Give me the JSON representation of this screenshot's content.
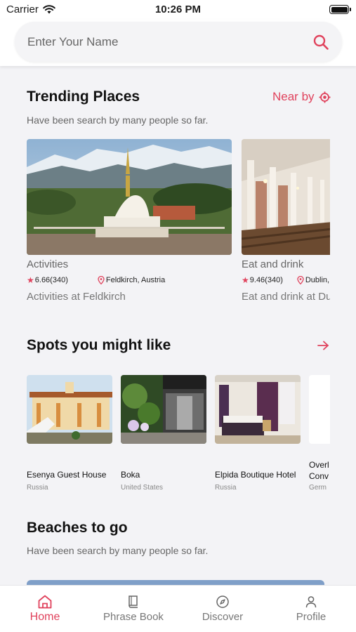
{
  "status_bar": {
    "carrier": "Carrier",
    "time": "10:26 PM"
  },
  "search": {
    "placeholder": "Enter Your Name"
  },
  "trending": {
    "title": "Trending Places",
    "subtitle": "Have been search by many people so far.",
    "nearby_label": "Near by",
    "cards": [
      {
        "category": "Activities",
        "rating": "6.66(340)",
        "location": "Feldkirch, Austria",
        "description": "Activities at Feldkirch"
      },
      {
        "category": "Eat and drink",
        "rating": "9.46(340)",
        "location": "Dublin, Ireland",
        "description": "Eat and drink at Dublin"
      }
    ]
  },
  "spots": {
    "title": "Spots you might like",
    "items": [
      {
        "name": "Esenya Guest House",
        "country": "Russia"
      },
      {
        "name": "Boka",
        "country": "United States"
      },
      {
        "name": "Elpida Boutique Hotel",
        "country": "Russia"
      },
      {
        "name": "Overl\nConv",
        "country": "Germ"
      }
    ]
  },
  "beaches": {
    "title": "Beaches to go",
    "subtitle": "Have been search by many people so far."
  },
  "tabs": [
    {
      "label": "Home",
      "active": true
    },
    {
      "label": "Phrase Book",
      "active": false
    },
    {
      "label": "Discover",
      "active": false
    },
    {
      "label": "Profile",
      "active": false
    }
  ],
  "colors": {
    "accent": "#e0425c",
    "background": "#f3f3f6"
  }
}
